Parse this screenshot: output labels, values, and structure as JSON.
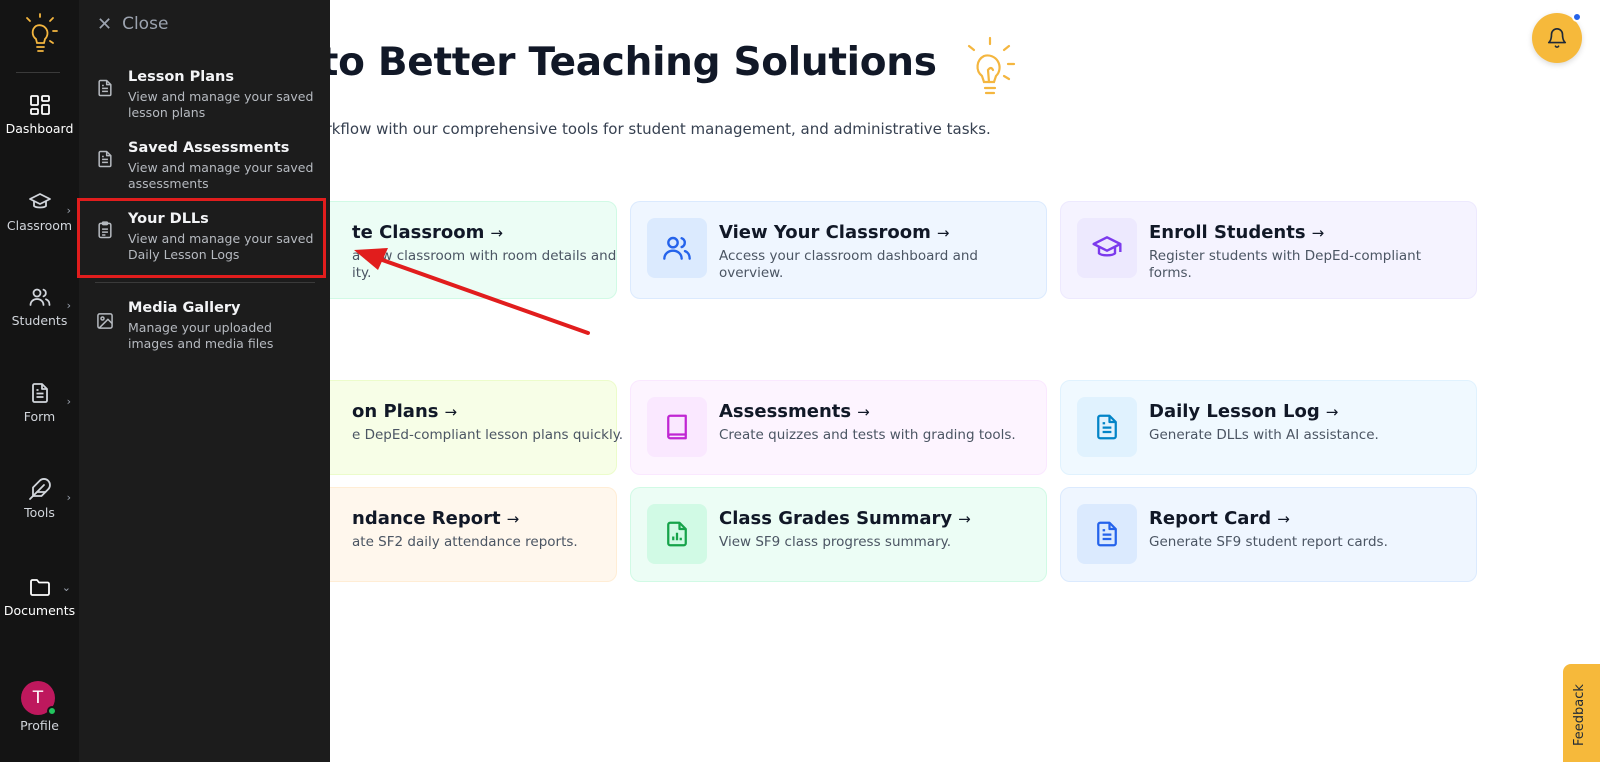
{
  "hero": {
    "title": "me to Better Teaching Solutions",
    "subtitle": "eaching workflow with our comprehensive tools for student management, and administrative tasks."
  },
  "cards": {
    "create_classroom": {
      "title": "te Classroom",
      "desc": "a new classroom with room details and\nity."
    },
    "view_classroom": {
      "title": "View Your Classroom",
      "desc": "Access your classroom dashboard and overview."
    },
    "enroll_students": {
      "title": "Enroll Students",
      "desc": "Register students with DepEd-compliant forms."
    },
    "lesson_plans": {
      "title": "on Plans",
      "desc": "e DepEd-compliant lesson plans quickly."
    },
    "assessments": {
      "title": "Assessments",
      "desc": "Create quizzes and tests with grading tools."
    },
    "daily_lesson_log": {
      "title": "Daily Lesson Log",
      "desc": "Generate DLLs with AI assistance."
    },
    "attendance_report": {
      "title": "ndance Report",
      "desc": "ate SF2 daily attendance reports."
    },
    "class_grades": {
      "title": "Class Grades Summary",
      "desc": "View SF9 class progress summary."
    },
    "report_card": {
      "title": "Report Card",
      "desc": "Generate SF9 student report cards."
    }
  },
  "arrow_glyph": "→",
  "rail": {
    "dashboard": "Dashboard",
    "classroom": "Classroom",
    "students": "Students",
    "form": "Form",
    "tools": "Tools",
    "documents": "Documents",
    "profile": "Profile",
    "avatar_initial": "T",
    "chevron_right": "›",
    "chevron_down": "⌄"
  },
  "drawer": {
    "close_icon": "✕",
    "close_label": "Close",
    "items": [
      {
        "title": "Lesson Plans",
        "desc": "View and manage your saved lesson plans",
        "icon": "document-icon"
      },
      {
        "title": "Saved Assessments",
        "desc": "View and manage your saved assessments",
        "icon": "document-icon"
      },
      {
        "title": "Your DLLs",
        "desc": "View and manage your saved Daily Lesson Logs",
        "icon": "clipboard-icon"
      },
      {
        "title": "Media Gallery",
        "desc": "Manage your uploaded images and media files",
        "icon": "image-icon"
      }
    ]
  },
  "feedback_label": "Feedback",
  "colors": {
    "accent": "#f6b93b",
    "highlight": "#e11d1d",
    "rail_bg": "#141414",
    "drawer_bg": "#1c1c1c"
  }
}
